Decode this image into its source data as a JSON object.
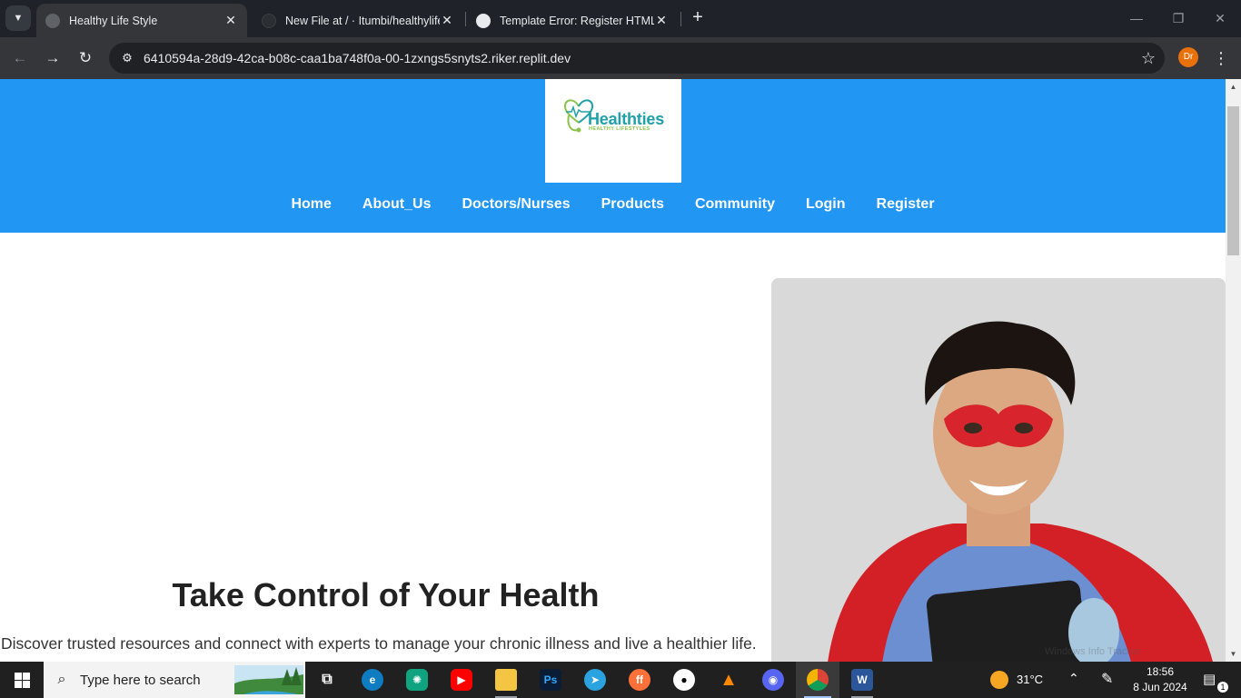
{
  "browser": {
    "tabs": [
      {
        "title": "Healthy Life Style",
        "active": true
      },
      {
        "title": "New File at / · Itumbi/healthylife",
        "active": false
      },
      {
        "title": "Template Error: Register HTML",
        "active": false
      }
    ],
    "url": "6410594a-28d9-42ca-b08c-caa1ba748f0a-00-1zxngs5snyts2.riker.replit.dev",
    "profile_initials": "Dr"
  },
  "site": {
    "logo": {
      "name": "Healthties",
      "tagline": "HEALTHY LIFESTYLES"
    },
    "nav": [
      "Home",
      "About_Us",
      "Doctors/Nurses",
      "Products",
      "Community",
      "Login",
      "Register"
    ],
    "hero": {
      "title": "Take Control of Your Health",
      "subtitle": "Discover trusted resources and connect with experts to manage your chronic illness and live a healthier life."
    },
    "watermark": "Windows Info Tracker"
  },
  "taskbar": {
    "search_placeholder": "Type here to search",
    "temperature": "31°C",
    "time": "18:56",
    "date": "8 Jun 2024",
    "notifications": "1"
  },
  "colors": {
    "brand_blue": "#2196f3",
    "logo_teal": "#20a0a8",
    "logo_green": "#8bc34a"
  }
}
